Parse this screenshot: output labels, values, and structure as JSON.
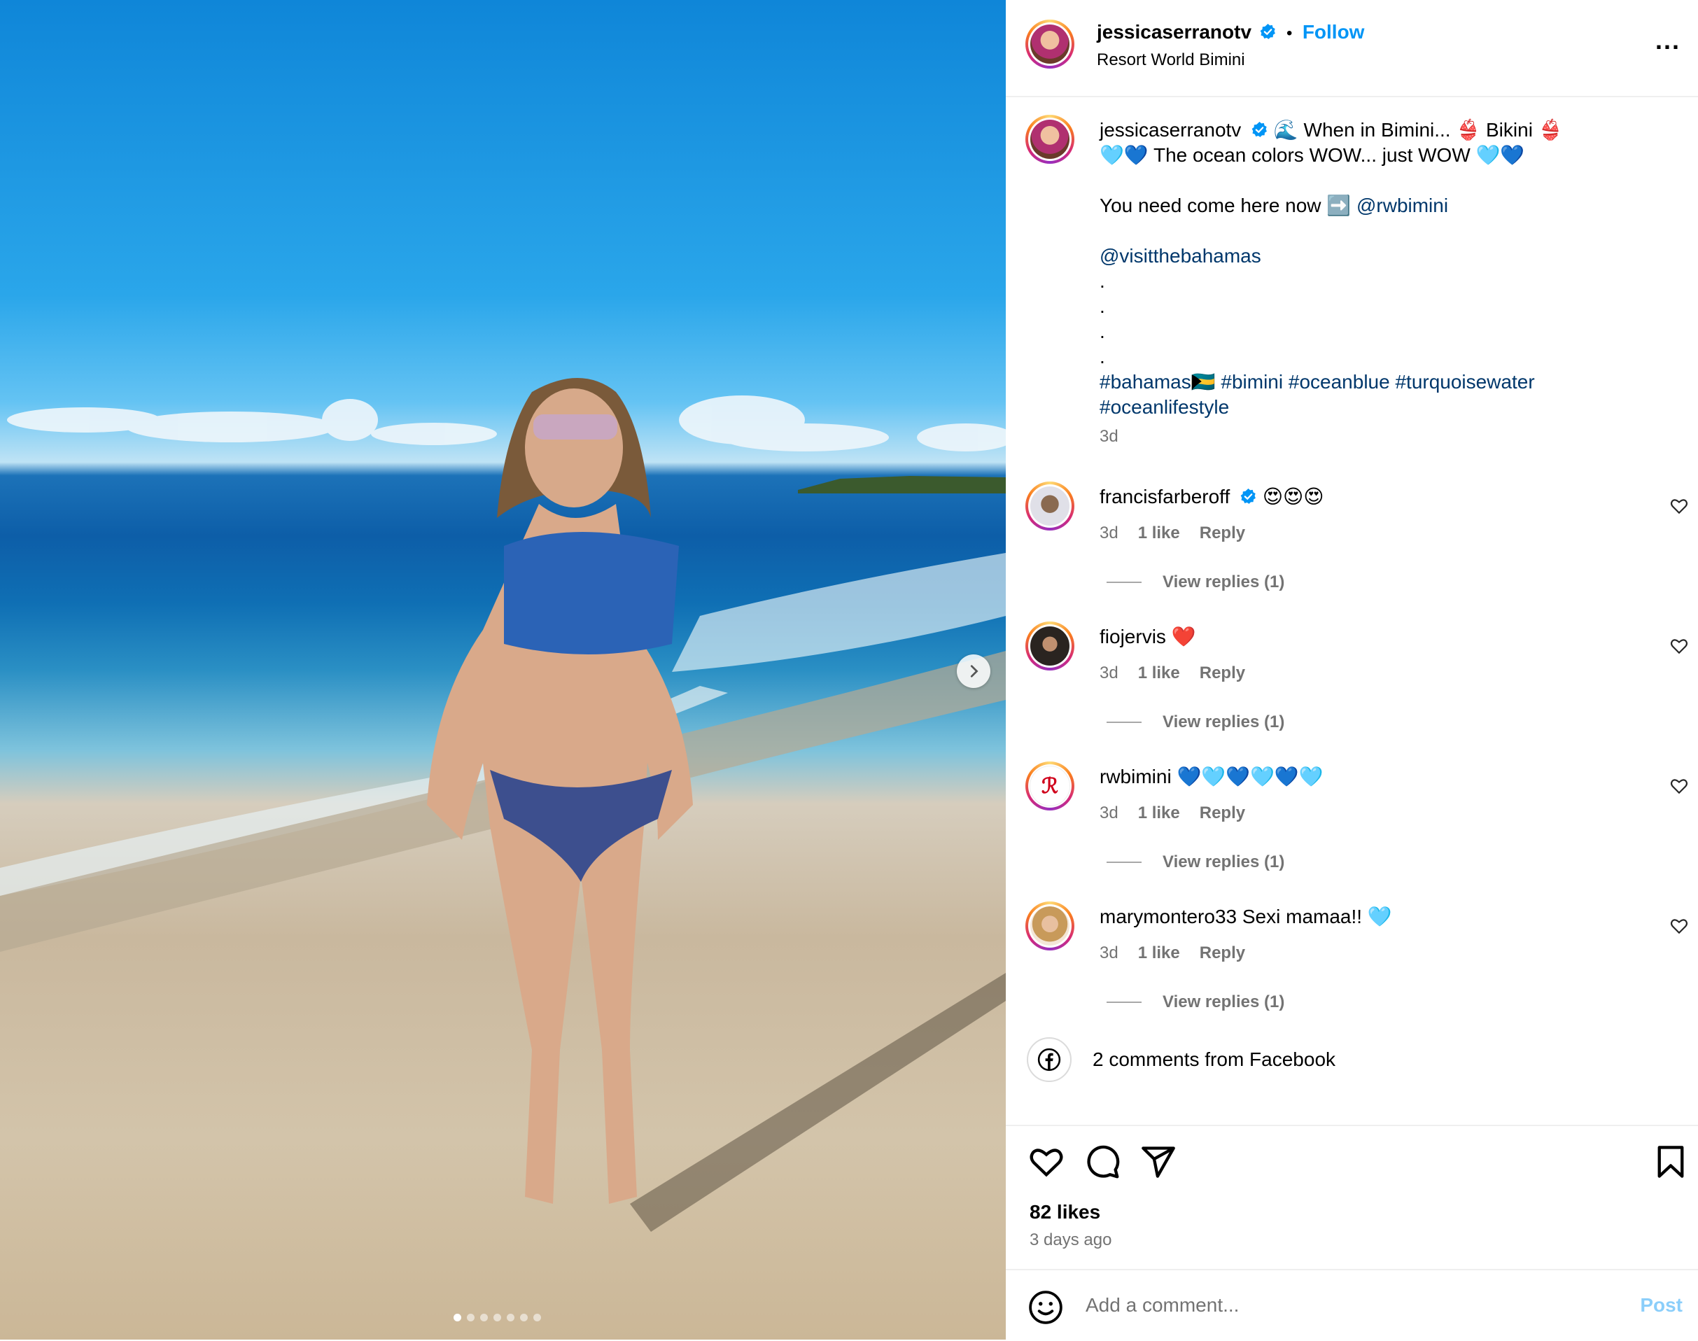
{
  "header": {
    "username": "jessicaserranotv",
    "separator": "•",
    "follow_label": "Follow",
    "location": "Resort World Bimini",
    "more_label": "..."
  },
  "caption": {
    "username": "jessicaserranotv",
    "line1": "🌊 When in Bimini... 👙 Bikini 👙",
    "line2": "🩵💙 The ocean colors WOW... just WOW 🩵💙",
    "line3": "You need come here now ➡️",
    "mention1": "@rwbimini",
    "mention2": "@visitthebahamas",
    "dot": ".",
    "hashtags1": "#bahamas🇧🇸 #bimini #oceanblue #turquoisewater",
    "hashtags2": "#oceanlifestyle",
    "time": "3d"
  },
  "comments": [
    {
      "username": "francisfarberoff",
      "text": "😍😍😍",
      "time": "3d",
      "likes": "1 like",
      "reply": "Reply",
      "replies": "View replies (1)"
    },
    {
      "username": "fiojervis",
      "text": "❤️",
      "time": "3d",
      "likes": "1 like",
      "reply": "Reply",
      "replies": "View replies (1)"
    },
    {
      "username": "rwbimini",
      "text": "💙🩵💙🩵💙🩵",
      "time": "3d",
      "likes": "1 like",
      "reply": "Reply",
      "replies": "View replies (1)"
    },
    {
      "username": "marymontero33",
      "text": "Sexi mamaa!! 🩵",
      "time": "3d",
      "likes": "1 like",
      "reply": "Reply",
      "replies": "View replies (1)"
    }
  ],
  "facebook": {
    "label": "2 comments from Facebook"
  },
  "footer": {
    "likes": "82 likes",
    "posted": "3 days ago",
    "comment_placeholder": "Add a comment...",
    "post_label": "Post"
  },
  "icons": {
    "verified": "verified-badge-icon",
    "like": "heart-icon",
    "comment": "comment-bubble-icon",
    "share": "paper-plane-icon",
    "save": "bookmark-icon",
    "emoji": "emoji-icon",
    "facebook": "facebook-icon",
    "next": "chevron-right-icon"
  },
  "carousel": {
    "total": 7,
    "active": 1
  },
  "colors": {
    "link": "#00376b",
    "follow": "#0095f6",
    "muted": "#737373"
  }
}
